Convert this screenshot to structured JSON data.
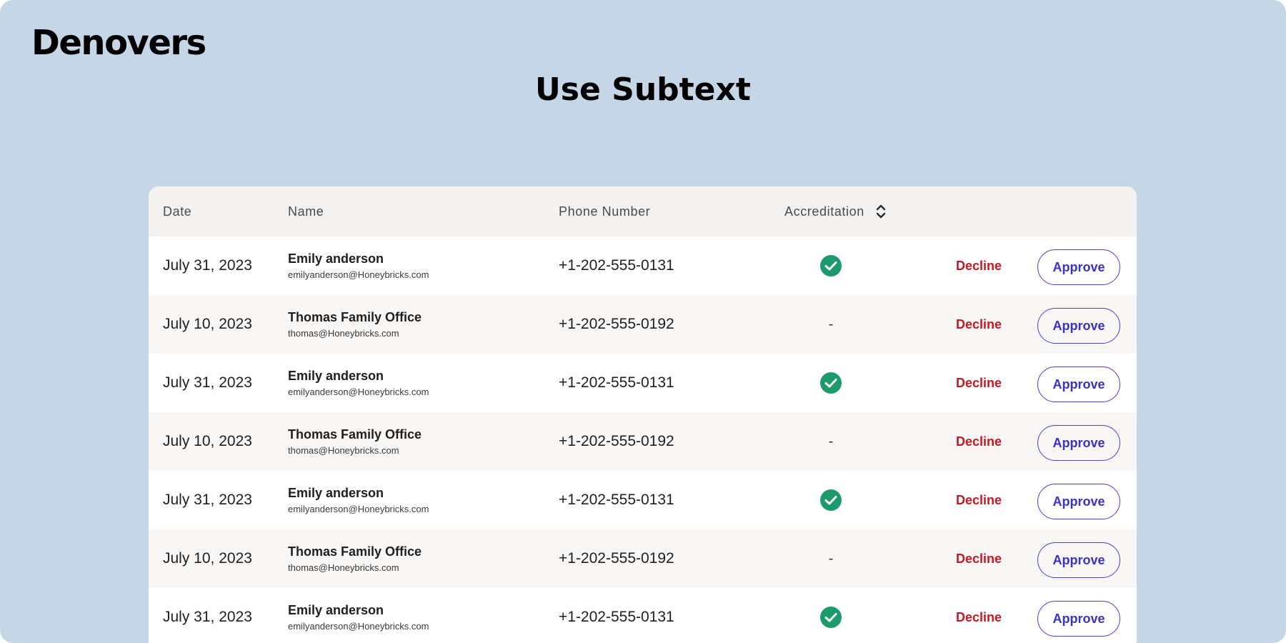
{
  "app": {
    "brand": "Denovers",
    "title": "Use Subtext"
  },
  "table": {
    "columns": {
      "date": "Date",
      "name": "Name",
      "phone": "Phone Number",
      "accreditation": "Accreditation"
    },
    "rows": [
      {
        "date": "July 31, 2023",
        "name": "Emily anderson",
        "email": "emilyanderson@Honeybricks.com",
        "phone": "+1-202-555-0131",
        "accredited": true,
        "dash": "-",
        "decline": "Decline",
        "approve": "Approve"
      },
      {
        "date": "July 10, 2023",
        "name": "Thomas Family Office",
        "email": "thomas@Honeybricks.com",
        "phone": "+1-202-555-0192",
        "accredited": false,
        "dash": "-",
        "decline": "Decline",
        "approve": "Approve"
      },
      {
        "date": "July 31, 2023",
        "name": "Emily anderson",
        "email": "emilyanderson@Honeybricks.com",
        "phone": "+1-202-555-0131",
        "accredited": true,
        "dash": "-",
        "decline": "Decline",
        "approve": "Approve"
      },
      {
        "date": "July 10, 2023",
        "name": "Thomas Family Office",
        "email": "thomas@Honeybricks.com",
        "phone": "+1-202-555-0192",
        "accredited": false,
        "dash": "-",
        "decline": "Decline",
        "approve": "Approve"
      },
      {
        "date": "July 31, 2023",
        "name": "Emily anderson",
        "email": "emilyanderson@Honeybricks.com",
        "phone": "+1-202-555-0131",
        "accredited": true,
        "dash": "-",
        "decline": "Decline",
        "approve": "Approve"
      },
      {
        "date": "July 10, 2023",
        "name": "Thomas Family Office",
        "email": "thomas@Honeybricks.com",
        "phone": "+1-202-555-0192",
        "accredited": false,
        "dash": "-",
        "decline": "Decline",
        "approve": "Approve"
      },
      {
        "date": "July 31, 2023",
        "name": "Emily anderson",
        "email": "emilyanderson@Honeybricks.com",
        "phone": "+1-202-555-0131",
        "accredited": true,
        "dash": "-",
        "decline": "Decline",
        "approve": "Approve"
      }
    ]
  },
  "icons": {
    "sort": "sort-icon",
    "accredited": "check-circle-icon"
  },
  "colors": {
    "background": "#c5d6e7",
    "header_bg": "#f4f2f0",
    "row_alt_bg": "#f8f7f5",
    "accredited_green": "#1d9a6c",
    "decline_red": "#c41922",
    "approve_blue": "#3a31c9"
  }
}
